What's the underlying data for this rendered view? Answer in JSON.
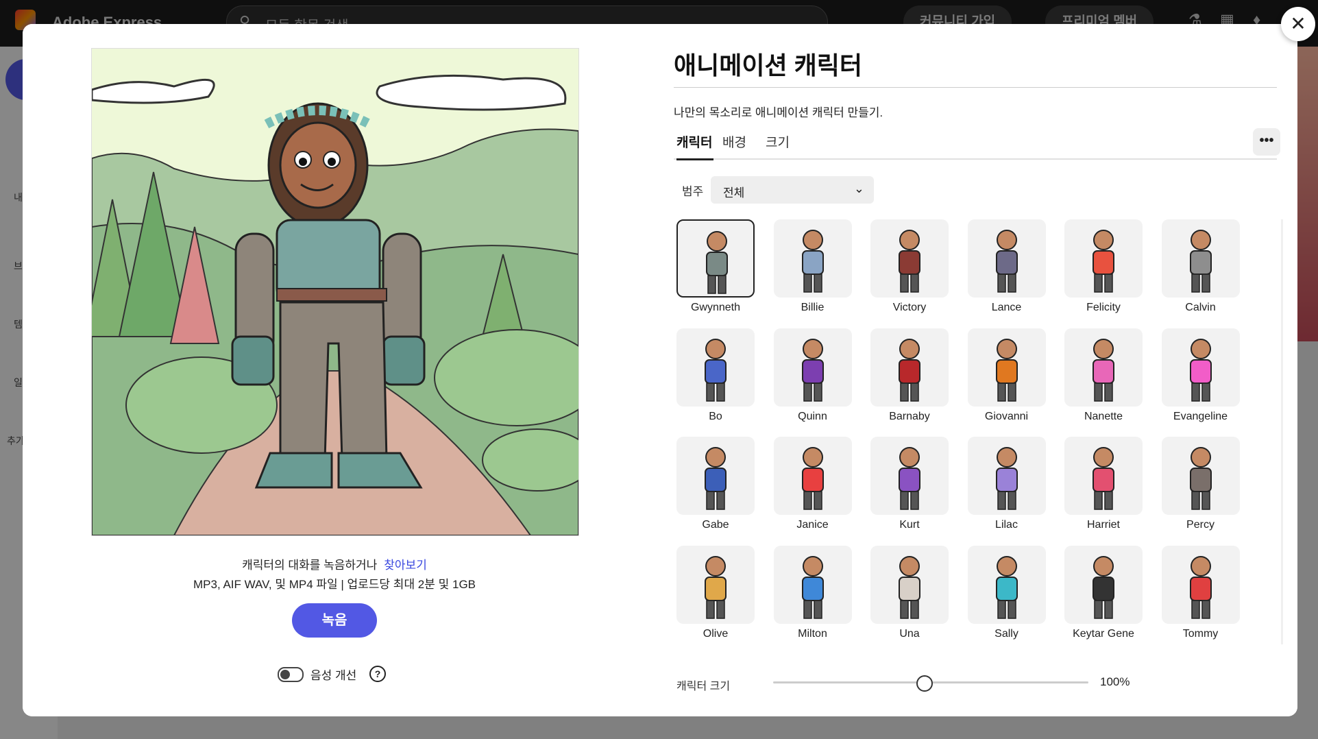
{
  "app": {
    "name": "Adobe Express",
    "search_placeholder": "모든 항목 검색",
    "community_button": "커뮤니티 가입",
    "premium_button": "프리미엄 멤버"
  },
  "sidebar": {
    "labels": [
      "내",
      "브",
      "템",
      "일",
      "추가"
    ]
  },
  "modal": {
    "close_icon": "close-icon",
    "left": {
      "record_prompt": "캐릭터의 대화를 녹음하거나",
      "browse_link": "찾아보기",
      "file_info": "MP3, AIF WAV, 및 MP4 파일 | 업로드당 최대 2분 및 1GB",
      "record_button": "녹음",
      "voice_enhance_label": "음성 개선",
      "voice_enhance_on": false
    },
    "right": {
      "title": "애니메이션 캐릭터",
      "subtitle": "나만의 목소리로 애니메이션 캐릭터 만들기.",
      "tabs": [
        "캐릭터",
        "배경",
        "크기"
      ],
      "active_tab": "캐릭터",
      "category_label": "범주",
      "category_value": "전체",
      "characters": [
        {
          "name": "Gwynneth",
          "selected": true,
          "color": "#7a8a86"
        },
        {
          "name": "Billie",
          "color": "#8aa4c4"
        },
        {
          "name": "Victory",
          "color": "#8b3b34"
        },
        {
          "name": "Lance",
          "color": "#6d6a88"
        },
        {
          "name": "Felicity",
          "color": "#e8523f"
        },
        {
          "name": "Calvin",
          "color": "#8e8e8e"
        },
        {
          "name": "Bo",
          "color": "#4a66c8"
        },
        {
          "name": "Quinn",
          "color": "#7c3fb0"
        },
        {
          "name": "Barnaby",
          "color": "#b8282b"
        },
        {
          "name": "Giovanni",
          "color": "#e07820"
        },
        {
          "name": "Nanette",
          "color": "#e867b8"
        },
        {
          "name": "Evangeline",
          "color": "#f25dc8"
        },
        {
          "name": "Gabe",
          "color": "#3c5fb8"
        },
        {
          "name": "Janice",
          "color": "#e84040"
        },
        {
          "name": "Kurt",
          "color": "#8a52c2"
        },
        {
          "name": "Lilac",
          "color": "#9a82d8"
        },
        {
          "name": "Harriet",
          "color": "#e35070"
        },
        {
          "name": "Percy",
          "color": "#7a6f6a"
        },
        {
          "name": "Olive",
          "color": "#e0a84a"
        },
        {
          "name": "Milton",
          "color": "#3f88d8"
        },
        {
          "name": "Una",
          "color": "#d8d0c8"
        },
        {
          "name": "Sally",
          "color": "#3cb8c8"
        },
        {
          "name": "Keytar Gene",
          "color": "#333333"
        },
        {
          "name": "Tommy",
          "color": "#e04040"
        }
      ],
      "size_label": "캐릭터 크기",
      "size_value": "100%",
      "size_fraction": 0.48
    }
  }
}
